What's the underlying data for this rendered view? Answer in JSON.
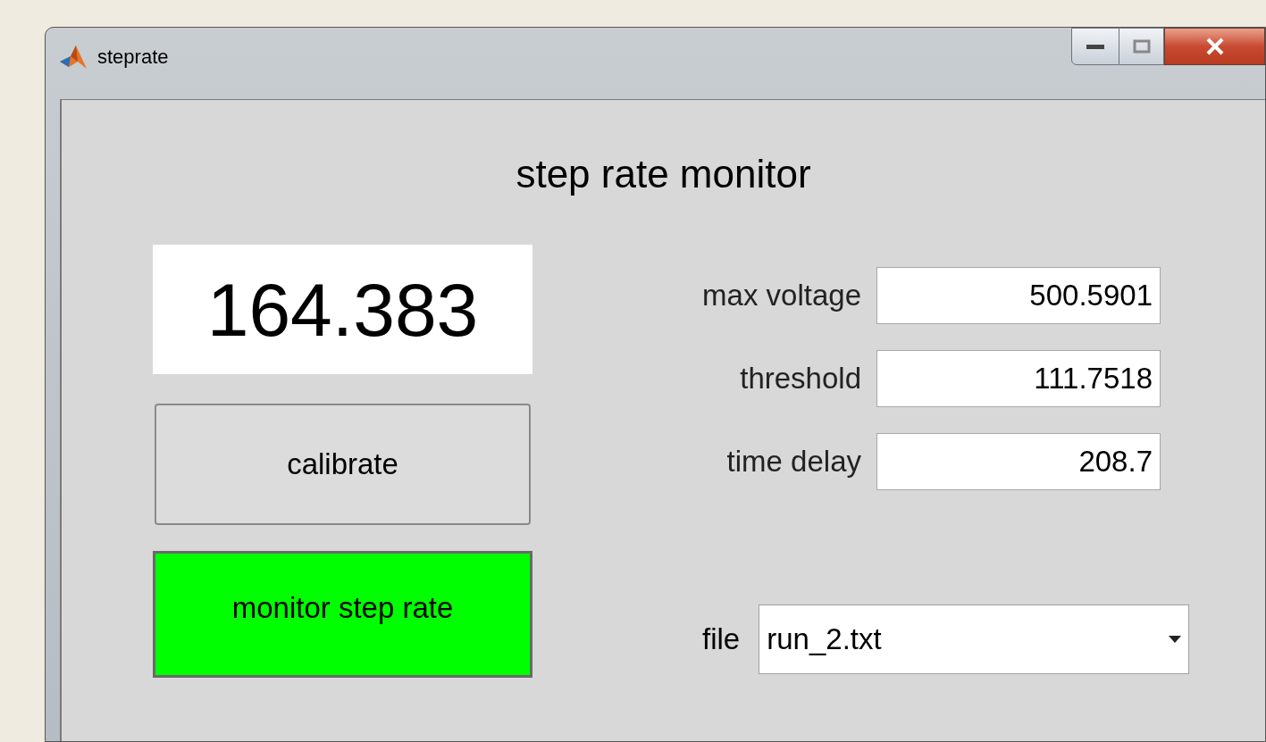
{
  "window": {
    "title": "steprate"
  },
  "heading": "step rate monitor",
  "display": {
    "value": "164.383"
  },
  "buttons": [
    {
      "label": "calibrate",
      "color": "#dcdcdc"
    },
    {
      "label": "monitor step rate",
      "color": "#00ff00"
    }
  ],
  "fields": [
    {
      "label": "max voltage",
      "value": "500.5901"
    },
    {
      "label": "threshold",
      "value": "111.7518"
    },
    {
      "label": "time delay",
      "value": "208.7"
    }
  ],
  "file": {
    "label": "file",
    "value": "run_2.txt"
  }
}
